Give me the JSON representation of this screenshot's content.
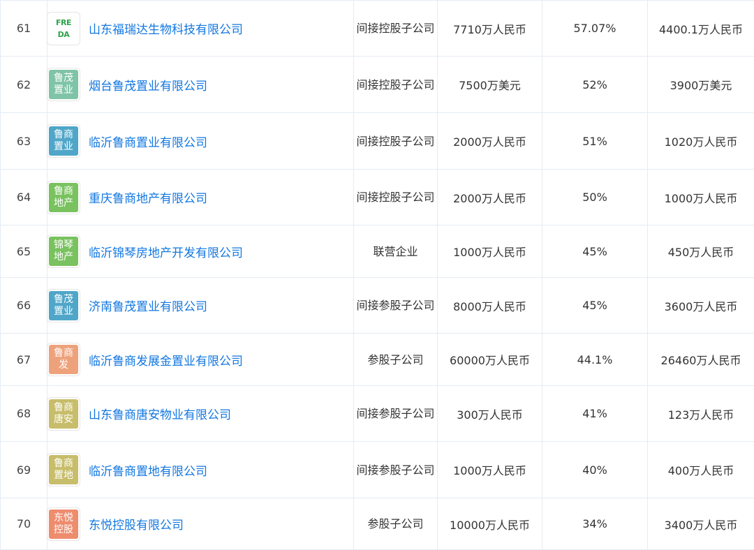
{
  "rows": [
    {
      "idx": "61",
      "logo_text": "FREDA",
      "logo_color": "#ffffff",
      "logo_is_text": true,
      "name": "山东福瑞达生物科技有限公司",
      "type": "间接控股子公司",
      "capital": "7710万人民币",
      "ratio": "57.07%",
      "amount": "4400.1万人民币"
    },
    {
      "idx": "62",
      "logo_text": "鲁茂置业",
      "logo_color": "#7fc4a6",
      "name": "烟台鲁茂置业有限公司",
      "type": "间接控股子公司",
      "capital": "7500万美元",
      "ratio": "52%",
      "amount": "3900万美元"
    },
    {
      "idx": "63",
      "logo_text": "鲁商置业",
      "logo_color": "#4fa6c9",
      "name": "临沂鲁商置业有限公司",
      "type": "间接控股子公司",
      "capital": "2000万人民币",
      "ratio": "51%",
      "amount": "1020万人民币"
    },
    {
      "idx": "64",
      "logo_text": "鲁商地产",
      "logo_color": "#79c25f",
      "name": "重庆鲁商地产有限公司",
      "type": "间接控股子公司",
      "capital": "2000万人民币",
      "ratio": "50%",
      "amount": "1000万人民币"
    },
    {
      "idx": "65",
      "logo_text": "锦琴地产",
      "logo_color": "#79c25f",
      "name": "临沂锦琴房地产开发有限公司",
      "type": "联营企业",
      "capital": "1000万人民币",
      "ratio": "45%",
      "amount": "450万人民币"
    },
    {
      "idx": "66",
      "logo_text": "鲁茂置业",
      "logo_color": "#4fa6c9",
      "name": "济南鲁茂置业有限公司",
      "type": "间接参股子公司",
      "capital": "8000万人民币",
      "ratio": "45%",
      "amount": "3600万人民币"
    },
    {
      "idx": "67",
      "logo_text": "鲁商发",
      "logo_color": "#eea27c",
      "name": "临沂鲁商发展金置业有限公司",
      "type": "参股子公司",
      "capital": "60000万人民币",
      "ratio": "44.1%",
      "amount": "26460万人民币"
    },
    {
      "idx": "68",
      "logo_text": "鲁商唐安",
      "logo_color": "#c7bd6a",
      "name": "山东鲁商唐安物业有限公司",
      "type": "间接参股子公司",
      "capital": "300万人民币",
      "ratio": "41%",
      "amount": "123万人民币"
    },
    {
      "idx": "69",
      "logo_text": "鲁商置地",
      "logo_color": "#c7bd6a",
      "name": "临沂鲁商置地有限公司",
      "type": "间接参股子公司",
      "capital": "1000万人民币",
      "ratio": "40%",
      "amount": "400万人民币"
    },
    {
      "idx": "70",
      "logo_text": "东悦控股",
      "logo_color": "#ee8c6e",
      "name": "东悦控股有限公司",
      "type": "参股子公司",
      "capital": "10000万人民币",
      "ratio": "34%",
      "amount": "3400万人民币"
    }
  ]
}
